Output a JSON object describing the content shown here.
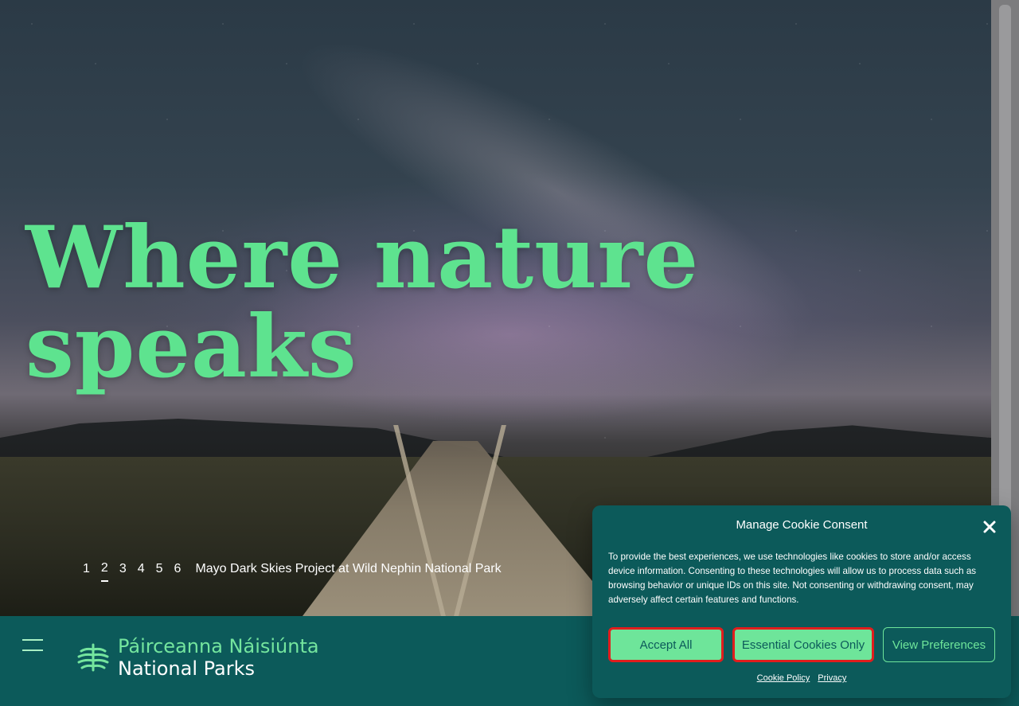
{
  "hero": {
    "title": "Where nature speaks",
    "slider": {
      "numbers": [
        "1",
        "2",
        "3",
        "4",
        "5",
        "6"
      ],
      "active_index": 1,
      "caption": "Mayo Dark Skies Project at Wild Nephin National Park"
    }
  },
  "brand": {
    "irish": "Páirceanna Náisiúnta",
    "english": "National Parks"
  },
  "cookie": {
    "title": "Manage Cookie Consent",
    "body": "To provide the best experiences, we use technologies like cookies to store and/or access device information. Consenting to these technologies will allow us to process data such as browsing behavior or unique IDs on this site. Not consenting or withdrawing consent, may adversely affect certain features and functions.",
    "buttons": {
      "accept": "Accept All",
      "essential": "Essential Cookies Only",
      "preferences": "View Preferences"
    },
    "links": {
      "cookie_policy": "Cookie Policy",
      "privacy": "Privacy"
    }
  },
  "colors": {
    "accent_green": "#6ee59a",
    "teal": "#0c5a5a",
    "highlight_red": "#e11d1d"
  },
  "icons": {
    "menu": "hamburger-menu-icon",
    "close": "close-icon",
    "logo": "national-parks-logo-icon"
  }
}
